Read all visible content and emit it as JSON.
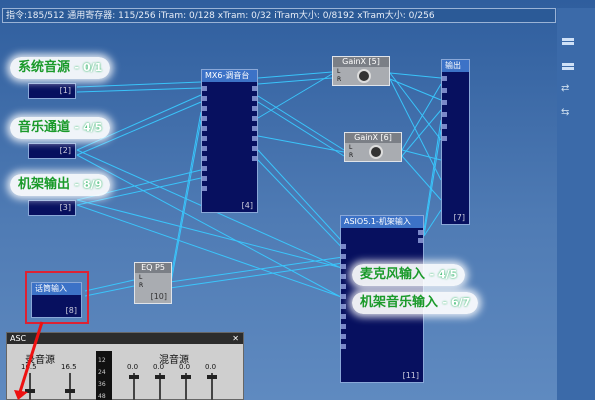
{
  "status_text": "指令:185/512 通用寄存器: 115/256 iTram: 0/128 xTram: 0/32 iTram大小: 0/8192 xTram大小: 0/256",
  "labels": {
    "system_source": "系统音源",
    "system_source_io": "0/1",
    "music_channel": "音乐通道",
    "music_channel_io": "4/5",
    "rack_output": "机架输出",
    "rack_output_io": "8/9",
    "microphone_input": "麦克风输入",
    "microphone_input_io": "4/5",
    "rack_music_input": "机架音乐输入",
    "rack_music_input_io": "6/7"
  },
  "modules": {
    "src1_num": "[1]",
    "src2_num": "[2]",
    "src3_num": "[3]",
    "mixer_title": "MX6-调音台",
    "mixer_num": "[4]",
    "gain5_title": "GainX [5]",
    "gain6_title": "GainX [6]",
    "gain_lr": "L\nR",
    "output_title": "输出",
    "output_num": "[7]",
    "mic_title": "话筒输入",
    "mic_num": "[8]",
    "eq_title": "EQ P5",
    "eq_num": "[10]",
    "asio_title": "ASIO5.1-机架输入",
    "asio_num": "[11]"
  },
  "bottom_panel": {
    "title": "ASC",
    "record_source": "录音源",
    "mix_source": "混音源",
    "values": [
      "16.5",
      "16.5",
      "0.0",
      "0.0",
      "0.0",
      "0.0"
    ],
    "meter_ticks": [
      "12",
      "24",
      "36",
      "48"
    ]
  },
  "colors": {
    "module_blue": "#07105f",
    "title_blue": "#3c72c7",
    "link_cyan": "#39c9ff",
    "tag_green": "#1a9a2a",
    "highlight_red": "#d23"
  }
}
